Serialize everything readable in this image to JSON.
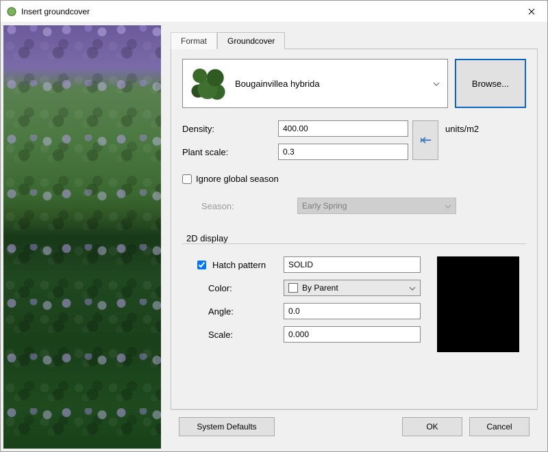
{
  "title": "Insert groundcover",
  "tabs": {
    "format": "Format",
    "groundcover": "Groundcover"
  },
  "plant": {
    "name": "Bougainvillea hybrida",
    "browse": "Browse..."
  },
  "density": {
    "label": "Density:",
    "value": "400.00",
    "units": "units/m2"
  },
  "plant_scale": {
    "label": "Plant scale:",
    "value": "0.3"
  },
  "ignore_season": {
    "label": "Ignore global season",
    "checked": false
  },
  "season": {
    "label": "Season:",
    "value": "Early Spring"
  },
  "display2d": {
    "group_title": "2D display",
    "hatch_label": "Hatch pattern",
    "hatch_checked": true,
    "hatch_value": "SOLID",
    "color_label": "Color:",
    "color_value": "By Parent",
    "angle_label": "Angle:",
    "angle_value": "0.0",
    "scale_label": "Scale:",
    "scale_value": "0.000"
  },
  "buttons": {
    "defaults": "System Defaults",
    "ok": "OK",
    "cancel": "Cancel"
  }
}
